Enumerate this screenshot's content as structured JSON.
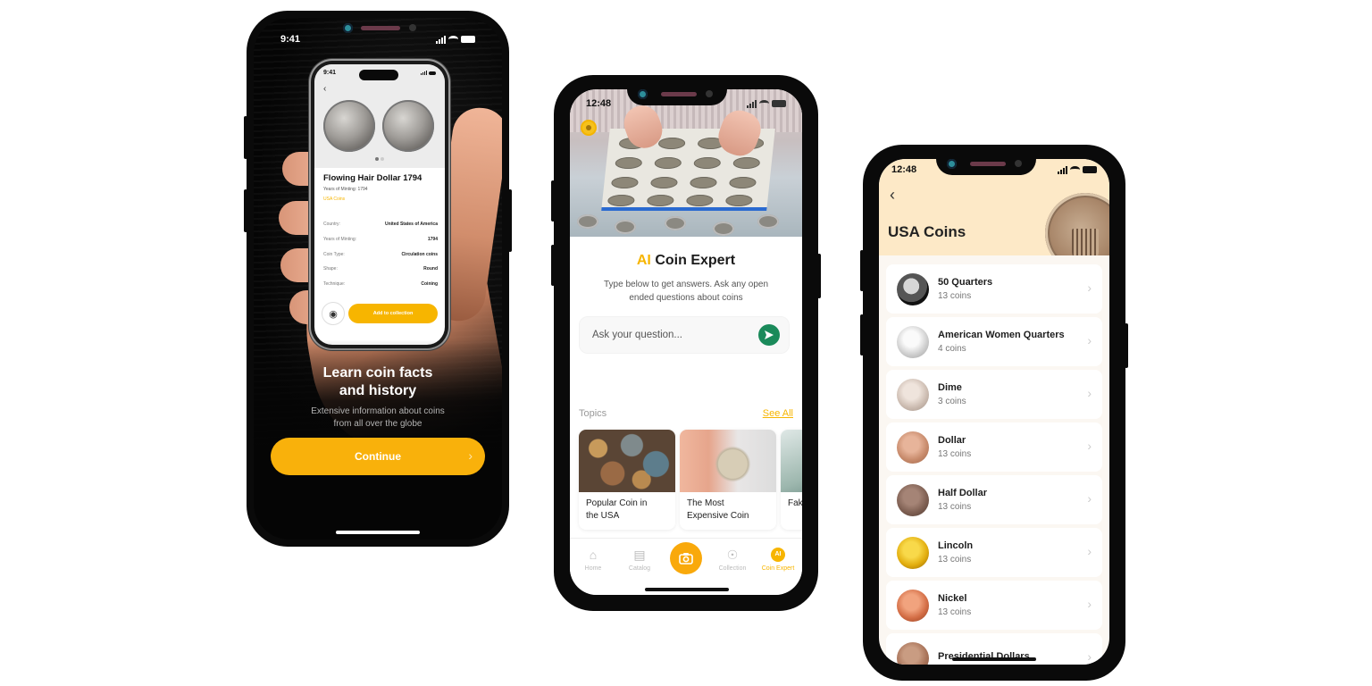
{
  "phone1": {
    "status_time": "9:41",
    "mini_phone": {
      "status_time": "9:41",
      "coin_title": "Flowing Hair Dollar 1794",
      "subtitle": "Years of Minting: 1794",
      "link": "USA Coins",
      "details": [
        {
          "label": "Country:",
          "value": "United States of America"
        },
        {
          "label": "Years of Minting:",
          "value": "1794"
        },
        {
          "label": "Coin Type:",
          "value": "Circulation coins"
        },
        {
          "label": "Shape:",
          "value": "Round"
        },
        {
          "label": "Technique:",
          "value": "Coining"
        }
      ],
      "add_button": "Add to collection",
      "carousel": {
        "pages": 2,
        "current": 1
      }
    },
    "headline_line1": "Learn coin facts",
    "headline_line2": "and history",
    "description_line1": "Extensive information about coins",
    "description_line2": "from all over the globe",
    "continue_label": "Continue"
  },
  "phone2": {
    "status_time": "12:48",
    "title_accent": "AI",
    "title_rest": " Coin Expert",
    "description_line1": "Type below to get answers. Ask any open",
    "description_line2": "ended questions about coins",
    "input_placeholder": "Ask your question...",
    "topics_label": "Topics",
    "see_all": "See All",
    "topics": [
      {
        "line1": "Popular Coin in",
        "line2": "the USA"
      },
      {
        "line1": "The Most",
        "line2": "Expensive Coin"
      },
      {
        "line1": "Fak",
        "line2": ""
      }
    ],
    "tabs": [
      {
        "label": "Home",
        "icon": "home-icon"
      },
      {
        "label": "Catalog",
        "icon": "catalog-icon"
      },
      {
        "label": "",
        "icon": "camera-icon"
      },
      {
        "label": "Collection",
        "icon": "collection-icon"
      },
      {
        "label": "Coin Expert",
        "icon": "ai-icon",
        "badge": "AI",
        "active": true
      }
    ],
    "accent_color": "#F7B500",
    "send_color": "#1A8A5A"
  },
  "phone3": {
    "status_time": "12:48",
    "title": "USA Coins",
    "coins": [
      {
        "name": "50 Quarters",
        "count": "13 coins"
      },
      {
        "name": "American Women Quarters",
        "count": "4 coins"
      },
      {
        "name": "Dime",
        "count": "3 coins"
      },
      {
        "name": "Dollar",
        "count": "13 coins"
      },
      {
        "name": "Half Dollar",
        "count": "13 coins"
      },
      {
        "name": "Lincoln",
        "count": "13 coins"
      },
      {
        "name": "Nickel",
        "count": "13 coins"
      },
      {
        "name": "Presidential Dollars",
        "count": ""
      }
    ],
    "header_color": "#FDE9C7"
  }
}
